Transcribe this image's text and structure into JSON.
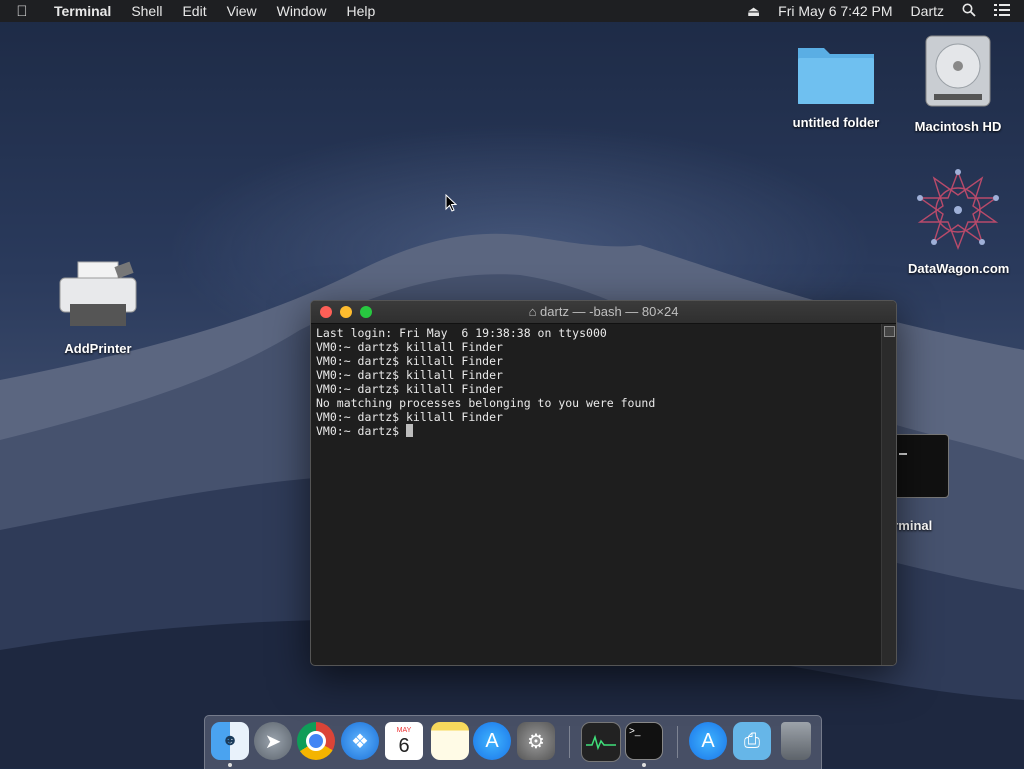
{
  "menubar": {
    "apple_icon": "apple-icon",
    "app_name": "Terminal",
    "menus": [
      "Shell",
      "Edit",
      "View",
      "Window",
      "Help"
    ],
    "eject_icon": "eject-icon",
    "datetime": "Fri May 6  7:42 PM",
    "user": "Dartz",
    "search_icon": "spotlight-search-icon",
    "notifications_icon": "notification-center-icon"
  },
  "desktop": {
    "icons": [
      {
        "label": "untitled folder",
        "icon": "folder-icon"
      },
      {
        "label": "Macintosh HD",
        "icon": "hard-drive-icon"
      },
      {
        "label": "DataWagon.com",
        "icon": "network-star-icon"
      },
      {
        "label": "AddPrinter",
        "icon": "printer-icon"
      },
      {
        "label": "erminal",
        "icon": "terminal-icon"
      }
    ]
  },
  "terminal": {
    "title": "dartz — -bash — 80×24",
    "title_icon": "home-icon",
    "lines": [
      "Last login: Fri May  6 19:38:38 on ttys000",
      "VM0:~ dartz$ killall Finder",
      "VM0:~ dartz$ killall Finder",
      "VM0:~ dartz$ killall Finder",
      "VM0:~ dartz$ killall Finder",
      "No matching processes belonging to you were found",
      "VM0:~ dartz$ killall Finder",
      "VM0:~ dartz$ "
    ]
  },
  "dock": {
    "items": [
      {
        "name": "Finder",
        "icon": "finder-icon",
        "running": true
      },
      {
        "name": "Launchpad",
        "icon": "rocket-icon",
        "running": false
      },
      {
        "name": "Chrome",
        "icon": "chrome-icon",
        "running": false
      },
      {
        "name": "Safari",
        "icon": "compass-icon",
        "running": false
      },
      {
        "name": "Calendar",
        "icon": "calendar-icon",
        "running": false,
        "badge_month": "MAY",
        "badge_day": "6"
      },
      {
        "name": "Notes",
        "icon": "notes-icon",
        "running": false
      },
      {
        "name": "App Store",
        "icon": "app-store-icon",
        "running": false
      },
      {
        "name": "System Preferences",
        "icon": "gear-icon",
        "running": false
      },
      {
        "name": "Activity Monitor",
        "icon": "activity-monitor-icon",
        "running": false
      },
      {
        "name": "Terminal",
        "icon": "terminal-icon",
        "running": true
      },
      {
        "name": "App Store",
        "icon": "app-store-icon",
        "running": false
      },
      {
        "name": "Downloads",
        "icon": "downloads-folder-icon",
        "running": false
      },
      {
        "name": "Trash",
        "icon": "trash-icon",
        "running": false
      }
    ]
  },
  "colors": {
    "close": "#fe5f57",
    "minimize": "#febc2e",
    "zoom": "#28c840",
    "terminal_bg": "#1e1e1e"
  }
}
